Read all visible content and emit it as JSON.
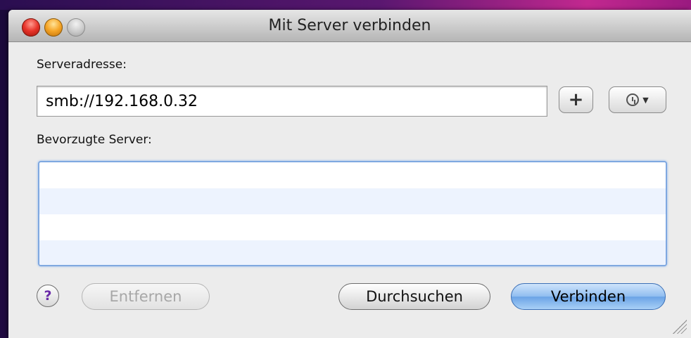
{
  "window": {
    "title": "Mit Server verbinden"
  },
  "form": {
    "server_address_label": "Serveradresse:",
    "server_address_value": "smb://192.168.0.32",
    "favorites_label": "Bevorzugte Server:",
    "favorites": []
  },
  "buttons": {
    "add_label": "+",
    "help_label": "?",
    "remove_label": "Entfernen",
    "browse_label": "Durchsuchen",
    "connect_label": "Verbinden"
  },
  "icons": {
    "recent_servers": "clock-icon",
    "recent_dropdown": "chevron-down-icon"
  },
  "colors": {
    "default_button": "#6aa3e6",
    "list_focus_ring": "#7fa8e0",
    "help_mark": "#6a2aa8"
  }
}
